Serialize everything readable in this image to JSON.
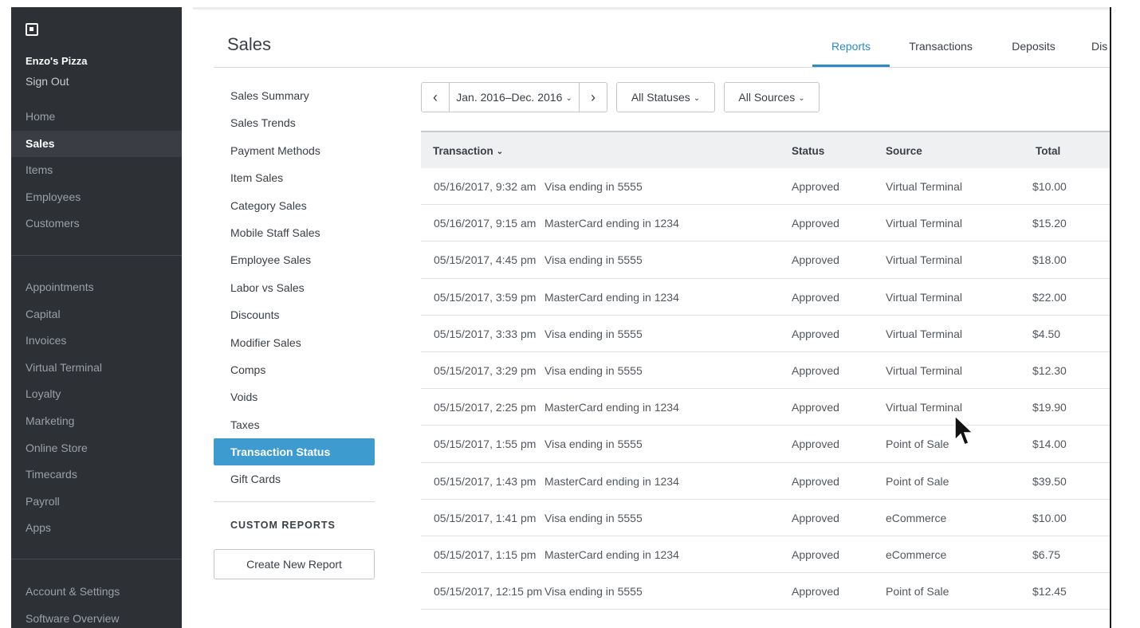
{
  "sidebar": {
    "business_name": "Enzo's Pizza",
    "sign_out": "Sign Out",
    "group1": [
      "Home",
      "Sales",
      "Items",
      "Employees",
      "Customers"
    ],
    "group2": [
      "Appointments",
      "Capital",
      "Invoices",
      "Virtual Terminal",
      "Loyalty",
      "Marketing",
      "Online Store",
      "Timecards",
      "Payroll",
      "Apps"
    ],
    "group3": [
      "Account & Settings",
      "Software Overview"
    ],
    "active": "Sales"
  },
  "header": {
    "title": "Sales",
    "tabs": [
      "Reports",
      "Transactions",
      "Deposits",
      "Dis"
    ],
    "active_tab": "Reports"
  },
  "reports_nav": {
    "items": [
      "Sales Summary",
      "Sales Trends",
      "Payment Methods",
      "Item Sales",
      "Category Sales",
      "Mobile Staff Sales",
      "Employee Sales",
      "Labor vs Sales",
      "Discounts",
      "Modifier Sales",
      "Comps",
      "Voids",
      "Taxes",
      "Transaction Status",
      "Gift Cards"
    ],
    "active": "Transaction Status",
    "custom_reports_title": "CUSTOM REPORTS",
    "create_button": "Create New Report"
  },
  "filters": {
    "prev": "‹",
    "date_range": "Jan. 2016–Dec. 2016",
    "next": "›",
    "status": "All Statuses",
    "source": "All Sources"
  },
  "table": {
    "columns": {
      "transaction": "Transaction",
      "status": "Status",
      "source": "Source",
      "total": "Total"
    },
    "rows": [
      {
        "date": "05/16/2017,  9:32 am",
        "card": "Visa ending in 5555",
        "status": "Approved",
        "source": "Virtual Terminal",
        "total": "$10.00"
      },
      {
        "date": "05/16/2017,  9:15 am",
        "card": "MasterCard ending in 1234",
        "status": "Approved",
        "source": "Virtual Terminal",
        "total": "$15.20"
      },
      {
        "date": "05/15/2017,  4:45 pm",
        "card": "Visa ending in 5555",
        "status": "Approved",
        "source": "Virtual Terminal",
        "total": "$18.00"
      },
      {
        "date": "05/15/2017,  3:59 pm",
        "card": "MasterCard ending in 1234",
        "status": "Approved",
        "source": "Virtual Terminal",
        "total": "$22.00"
      },
      {
        "date": "05/15/2017,  3:33 pm",
        "card": "Visa ending in 5555",
        "status": "Approved",
        "source": "Virtual Terminal",
        "total": "$4.50"
      },
      {
        "date": "05/15/2017,  3:29 pm",
        "card": "Visa ending in 5555",
        "status": "Approved",
        "source": "Virtual Terminal",
        "total": "$12.30"
      },
      {
        "date": "05/15/2017,  2:25 pm",
        "card": "MasterCard ending in 1234",
        "status": "Approved",
        "source": "Virtual Terminal",
        "total": "$19.90"
      },
      {
        "date": "05/15/2017,  1:55 pm",
        "card": "Visa ending in 5555",
        "status": "Approved",
        "source": "Point of Sale",
        "total": "$14.00"
      },
      {
        "date": "05/15/2017,  1:43 pm",
        "card": "MasterCard ending in 1234",
        "status": "Approved",
        "source": "Point of Sale",
        "total": "$39.50"
      },
      {
        "date": "05/15/2017,  1:41 pm",
        "card": "Visa ending in 5555",
        "status": "Approved",
        "source": "eCommerce",
        "total": "$10.00"
      },
      {
        "date": "05/15/2017,  1:15 pm",
        "card": "MasterCard ending in 1234",
        "status": "Approved",
        "source": "eCommerce",
        "total": "$6.75"
      },
      {
        "date": "05/15/2017, 12:15 pm",
        "card": "Visa ending in 5555",
        "status": "Approved",
        "source": "Point of Sale",
        "total": "$12.45"
      }
    ]
  },
  "colors": {
    "accent": "#2b8cc4",
    "sidebar_bg": "#2d3136",
    "active_report": "#3d9bd0"
  }
}
